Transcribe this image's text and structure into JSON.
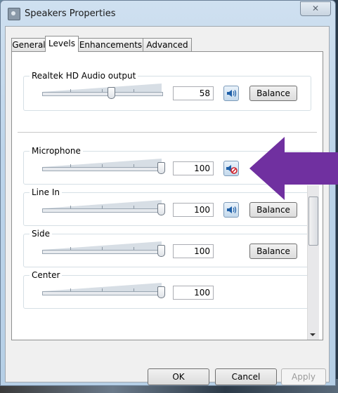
{
  "window": {
    "title": "Speakers Properties",
    "close_glyph": "✕"
  },
  "tabs": [
    {
      "label": "General",
      "active": false
    },
    {
      "label": "Levels",
      "active": true
    },
    {
      "label": "Enhancements",
      "active": false
    },
    {
      "label": "Advanced",
      "active": false
    }
  ],
  "levels": [
    {
      "name": "Realtek HD Audio output",
      "value": "58",
      "level_fraction": 0.58,
      "speaker_icon": "speaker-icon",
      "muted": false,
      "has_balance": true
    },
    {
      "name": "Microphone",
      "value": "100",
      "level_fraction": 1.0,
      "speaker_icon": "speaker-muted-icon",
      "muted": true,
      "has_balance": false
    },
    {
      "name": "Line In",
      "value": "100",
      "level_fraction": 1.0,
      "speaker_icon": "speaker-icon",
      "muted": false,
      "has_balance": true
    },
    {
      "name": "Side",
      "value": "100",
      "level_fraction": 1.0,
      "has_speaker": false,
      "has_balance": true
    },
    {
      "name": "Center",
      "value": "100",
      "level_fraction": 1.0,
      "has_speaker": false,
      "has_balance": false
    }
  ],
  "balance_label": "Balance",
  "buttons": {
    "ok": "OK",
    "cancel": "Cancel",
    "apply": "Apply"
  },
  "annotation": {
    "icon": "arrow-icon",
    "color": "#7030a0"
  }
}
